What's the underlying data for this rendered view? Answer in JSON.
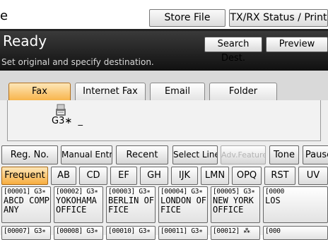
{
  "topbar": {
    "title_fragment": "e",
    "store_file": "Store File",
    "txrx_status": "TX/RX Status / Print"
  },
  "header": {
    "status": "Ready",
    "instruction": "Set original and specify destination.",
    "search_dest": "Search Dest.",
    "preview": "Preview"
  },
  "tabs": [
    "Fax",
    "Internet Fax",
    "Email",
    "Folder"
  ],
  "destination": {
    "icon": "fax-machine-icon",
    "line_type": "G3∗",
    "number": "_"
  },
  "functions": [
    "Reg. No.",
    "Manual Entry",
    "Recent",
    "Select Line",
    "Adv.Features",
    "Tone",
    "Pause"
  ],
  "categories": [
    "Frequent",
    "AB",
    "CD",
    "EF",
    "GH",
    "IJK",
    "LMN",
    "OPQ",
    "RST",
    "UV"
  ],
  "destinations_row1": [
    {
      "code": "[00001] G3∗",
      "name": "ABCD COMPANY"
    },
    {
      "code": "[00002] G3∗",
      "name": "YOKOHAMA OFFICE"
    },
    {
      "code": "[00003] G3∗",
      "name": "BERLIN OFFICE"
    },
    {
      "code": "[00004] G3∗",
      "name": "LONDON OFFICE"
    },
    {
      "code": "[00005] G3∗",
      "name": "NEW YORK OFFICE"
    },
    {
      "code": "[0000",
      "name": "LOS"
    }
  ],
  "destinations_row2": [
    {
      "code": "[00007] G3∗",
      "name": ""
    },
    {
      "code": "[00008] G3∗",
      "name": ""
    },
    {
      "code": "[00010] G3∗",
      "name": ""
    },
    {
      "code": "[00011] G3∗",
      "name": ""
    },
    {
      "code": "[00012] ⁂",
      "name": ""
    },
    {
      "code": "[000",
      "name": ""
    }
  ],
  "colors": {
    "header_bg": "#1a1a1a",
    "active_tab": "#f8b54c",
    "panel_bg": "#eeeeee"
  }
}
